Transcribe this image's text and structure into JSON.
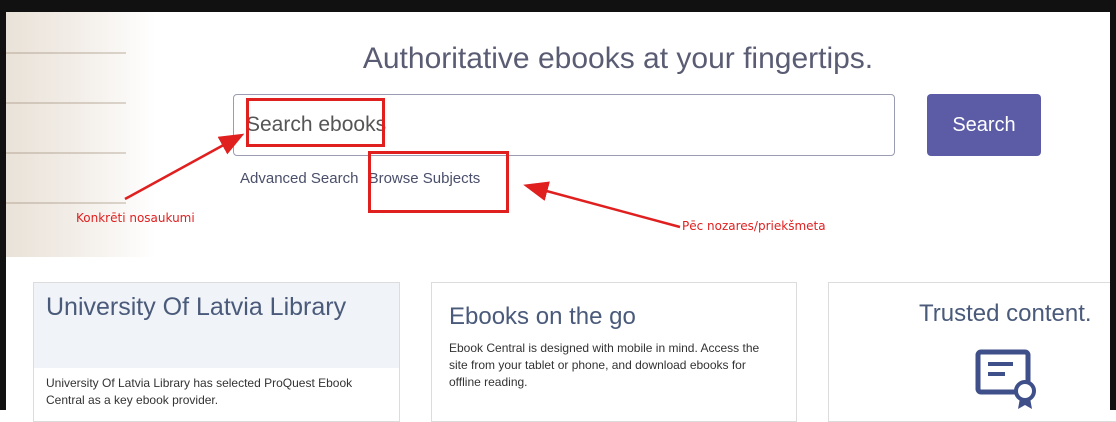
{
  "hero": {
    "headline": "Authoritative ebooks at your fingertips.",
    "search_placeholder": "Search ebooks",
    "search_button": "Search",
    "advanced_search": "Advanced Search",
    "browse_subjects": "Browse Subjects"
  },
  "annotations": {
    "left_note": "Konkrēti nosaukumi",
    "right_note": "Pēc nozares/priekšmeta"
  },
  "cards": {
    "library": {
      "title": "University Of Latvia Library",
      "body": "University Of Latvia Library has selected ProQuest Ebook Central as a key ebook provider."
    },
    "mobile": {
      "title": "Ebooks on the go",
      "body": "Ebook Central is designed with mobile in mind. Access the site from your tablet or phone, and download ebooks for offline reading."
    },
    "trusted": {
      "title": "Trusted content."
    }
  },
  "colors": {
    "accent": "#5b5ba6",
    "annotation_red": "#e01f1f"
  },
  "icons": {
    "trusted": "certificate-icon"
  }
}
